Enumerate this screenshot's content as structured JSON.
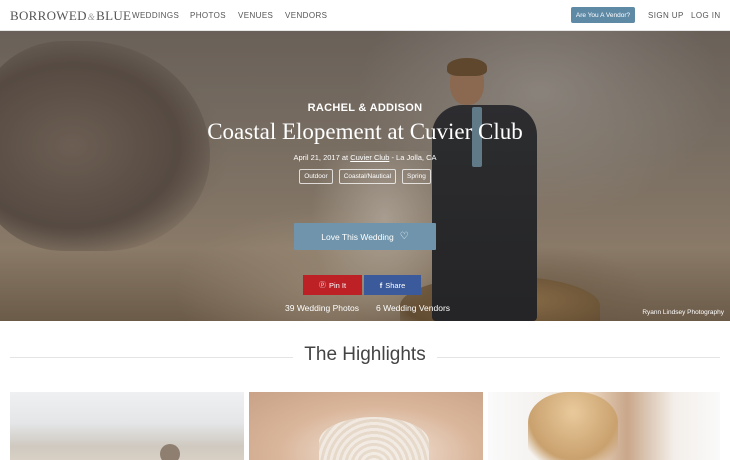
{
  "nav": {
    "logo_left": "BORROWED",
    "logo_amp": "&",
    "logo_right": "BLUE",
    "links": [
      "WEDDINGS",
      "PHOTOS",
      "VENUES",
      "VENDORS"
    ],
    "vendor_button": "Are You A Vendor?",
    "sign_up": "SIGN UP",
    "log_in": "LOG IN"
  },
  "hero": {
    "couple": "RACHEL & ADDISON",
    "title": "Coastal Elopement at Cuvier Club",
    "date_prefix": "April 21, 2017 at ",
    "venue": "Cuvier Club",
    "location": " - La Jolla, CA",
    "tags": [
      "Outdoor",
      "Coastal/Nautical",
      "Spring"
    ],
    "love_button": "Love This Wedding",
    "love_icon": "heart-outline-icon",
    "pin_icon": "pinterest-icon",
    "pin_label": "Pin It",
    "share_icon": "facebook-icon",
    "share_label": "Share",
    "photos_count": "39 Wedding Photos",
    "vendors_count": "6 Wedding Vendors",
    "photo_credit": "Ryann Lindsey Photography"
  },
  "highlights": {
    "title": "The Highlights"
  },
  "colors": {
    "love_button": "#6f94ab",
    "pin_button": "#bd2126",
    "share_button": "#3b5a9b",
    "vendor_button": "#5f8aa6"
  }
}
